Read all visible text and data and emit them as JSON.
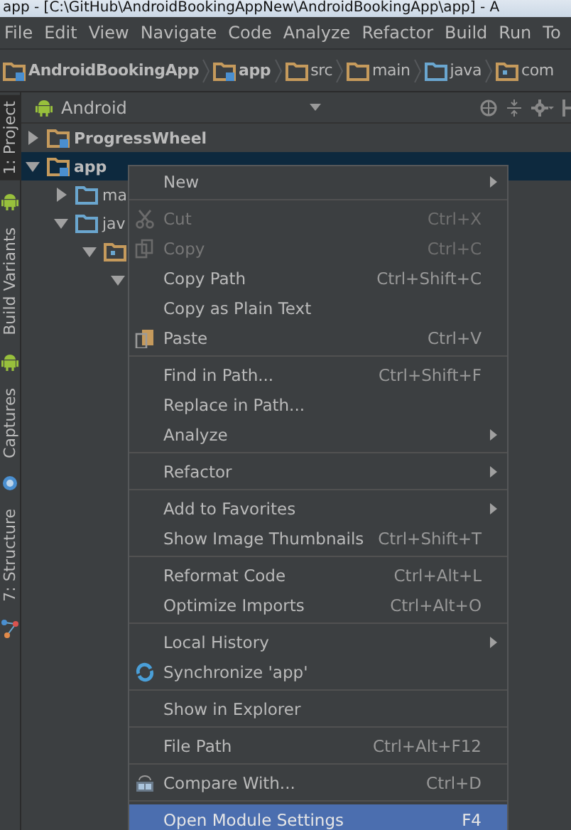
{
  "window": {
    "title": "app - [C:\\GitHub\\AndroidBookingAppNew\\AndroidBookingApp\\app] - A"
  },
  "menu_bar": [
    "File",
    "Edit",
    "View",
    "Navigate",
    "Code",
    "Analyze",
    "Refactor",
    "Build",
    "Run",
    "To"
  ],
  "breadcrumbs": [
    {
      "label": "AndroidBookingApp",
      "kind": "module"
    },
    {
      "label": "app",
      "kind": "module"
    },
    {
      "label": "src",
      "kind": "folder"
    },
    {
      "label": "main",
      "kind": "folder"
    },
    {
      "label": "java",
      "kind": "source"
    },
    {
      "label": "com",
      "kind": "package"
    }
  ],
  "tool_strip": [
    {
      "label": "1: Project",
      "selected": true,
      "kind": "android"
    },
    {
      "label": "Build Variants",
      "selected": false,
      "kind": "android"
    },
    {
      "label": "Captures",
      "selected": false,
      "kind": "capture"
    },
    {
      "label": "7: Structure",
      "selected": false,
      "kind": "structure"
    }
  ],
  "project_panel": {
    "view": "Android",
    "tree": [
      {
        "label": "ProgressWheel",
        "kind": "module",
        "expanded": false,
        "selected": false
      },
      {
        "label": "app",
        "kind": "module",
        "expanded": true,
        "selected": true,
        "children": [
          {
            "label": "ma",
            "kind": "source",
            "expanded": false,
            "selected": false
          },
          {
            "label": "jav",
            "kind": "source",
            "expanded": true,
            "selected": false,
            "children": [
              {
                "kind": "package",
                "expanded": true,
                "selected": false,
                "children": [
                  {
                    "expanded": true,
                    "selected": false
                  }
                ]
              }
            ]
          }
        ]
      }
    ]
  },
  "context_menu": [
    {
      "kind": "item",
      "label": "New",
      "submenu": true,
      "disabled": false,
      "selected": false
    },
    {
      "kind": "separator"
    },
    {
      "kind": "cut",
      "label": "Cut",
      "shortcut": "Ctrl+X",
      "submenu": false,
      "disabled": true,
      "selected": false
    },
    {
      "kind": "copy",
      "label": "Copy",
      "shortcut": "Ctrl+C",
      "submenu": false,
      "disabled": true,
      "selected": false
    },
    {
      "kind": "item",
      "label": "Copy Path",
      "shortcut": "Ctrl+Shift+C",
      "submenu": false,
      "disabled": false,
      "selected": false
    },
    {
      "kind": "item",
      "label": "Copy as Plain Text",
      "submenu": false,
      "disabled": false,
      "selected": false
    },
    {
      "kind": "paste",
      "label": "Paste",
      "shortcut": "Ctrl+V",
      "submenu": false,
      "disabled": false,
      "selected": false
    },
    {
      "kind": "separator"
    },
    {
      "kind": "item",
      "label": "Find in Path...",
      "shortcut": "Ctrl+Shift+F",
      "submenu": false,
      "disabled": false,
      "selected": false
    },
    {
      "kind": "item",
      "label": "Replace in Path...",
      "submenu": false,
      "disabled": false,
      "selected": false
    },
    {
      "kind": "item",
      "label": "Analyze",
      "submenu": true,
      "disabled": false,
      "selected": false
    },
    {
      "kind": "separator"
    },
    {
      "kind": "item",
      "label": "Refactor",
      "submenu": true,
      "disabled": false,
      "selected": false
    },
    {
      "kind": "separator"
    },
    {
      "kind": "item",
      "label": "Add to Favorites",
      "submenu": true,
      "disabled": false,
      "selected": false
    },
    {
      "kind": "item",
      "label": "Show Image Thumbnails",
      "shortcut": "Ctrl+Shift+T",
      "submenu": false,
      "disabled": false,
      "selected": false
    },
    {
      "kind": "separator"
    },
    {
      "kind": "item",
      "label": "Reformat Code",
      "shortcut": "Ctrl+Alt+L",
      "submenu": false,
      "disabled": false,
      "selected": false
    },
    {
      "kind": "item",
      "label": "Optimize Imports",
      "shortcut": "Ctrl+Alt+O",
      "submenu": false,
      "disabled": false,
      "selected": false
    },
    {
      "kind": "separator"
    },
    {
      "kind": "item",
      "label": "Local History",
      "submenu": true,
      "disabled": false,
      "selected": false
    },
    {
      "kind": "sync",
      "label": "Synchronize 'app'",
      "submenu": false,
      "disabled": false,
      "selected": false
    },
    {
      "kind": "separator"
    },
    {
      "kind": "item",
      "label": "Show in Explorer",
      "submenu": false,
      "disabled": false,
      "selected": false
    },
    {
      "kind": "separator"
    },
    {
      "kind": "item",
      "label": "File Path",
      "shortcut": "Ctrl+Alt+F12",
      "submenu": false,
      "disabled": false,
      "selected": false
    },
    {
      "kind": "separator"
    },
    {
      "kind": "compare",
      "label": "Compare With...",
      "shortcut": "Ctrl+D",
      "submenu": false,
      "disabled": false,
      "selected": false
    },
    {
      "kind": "separator"
    },
    {
      "kind": "item",
      "label": "Open Module Settings",
      "shortcut": "F4",
      "submenu": false,
      "disabled": false,
      "selected": true
    }
  ]
}
